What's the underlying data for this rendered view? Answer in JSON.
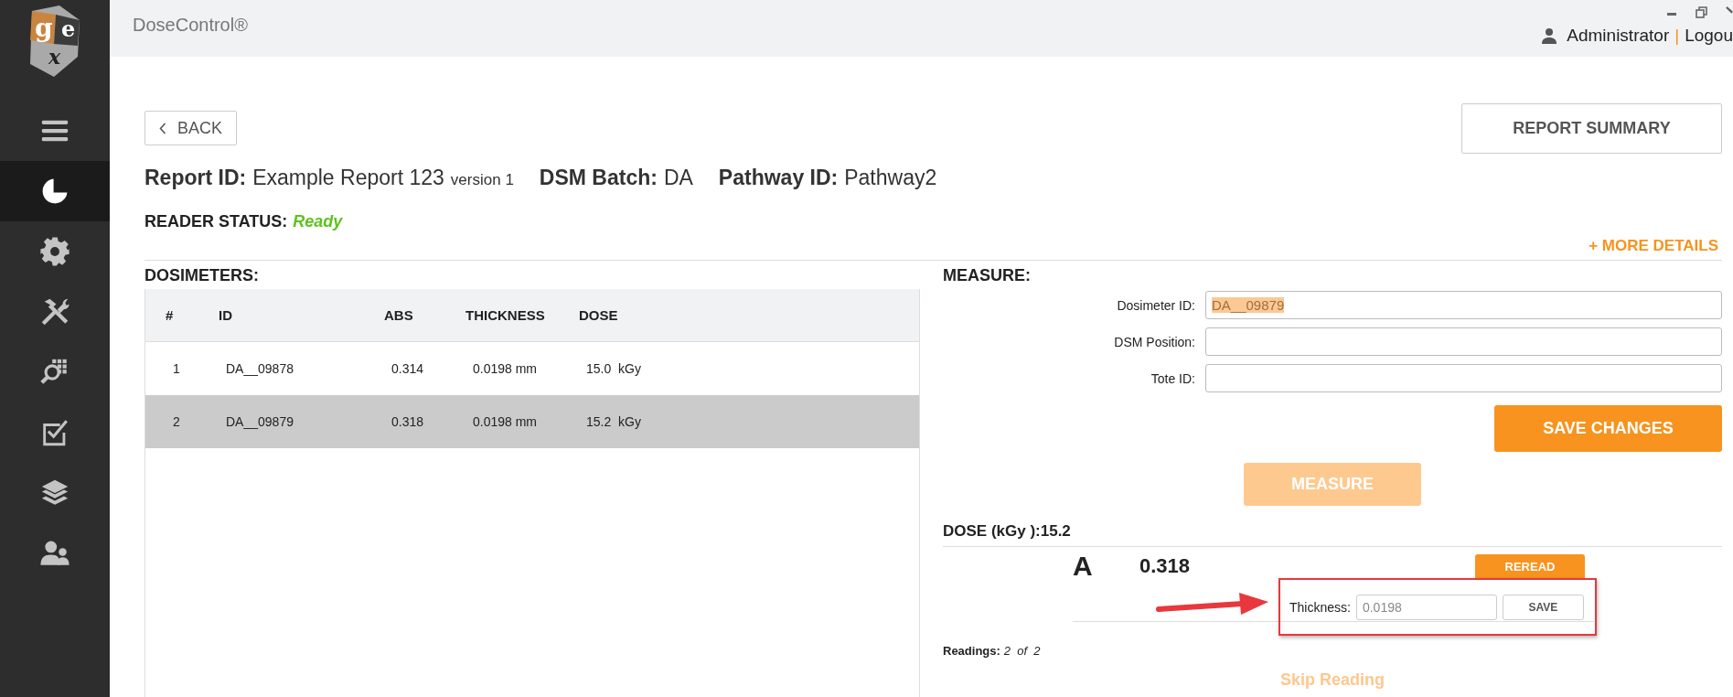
{
  "logo": {
    "letters": [
      "g",
      "e",
      "x"
    ]
  },
  "app": {
    "title": "DoseControl®"
  },
  "user": {
    "name": "Administrator",
    "separator": "|",
    "logout": "Logou"
  },
  "sidebar": {
    "items": [
      {
        "kind": "menu",
        "selected": false
      },
      {
        "kind": "pie",
        "selected": true
      },
      {
        "kind": "gear",
        "selected": false
      },
      {
        "kind": "tools",
        "selected": false
      },
      {
        "kind": "search",
        "selected": false
      },
      {
        "kind": "checklist",
        "selected": false
      },
      {
        "kind": "layers",
        "selected": false
      },
      {
        "kind": "users",
        "selected": false
      }
    ]
  },
  "back_button": "BACK",
  "report_summary_button": "REPORT SUMMARY",
  "report_info": [
    {
      "label": "Report ID:",
      "value": "Example Report 123",
      "suffix": "version 1"
    },
    {
      "label": "DSM Batch:",
      "value": "DA"
    },
    {
      "label": "Pathway ID:",
      "value": "Pathway2"
    }
  ],
  "reader_status": {
    "label": "READER STATUS:",
    "value": "Ready"
  },
  "more_details": "+ MORE DETAILS",
  "dosimeters": {
    "title": "DOSIMETERS:",
    "columns": [
      "#",
      "ID",
      "ABS",
      "THICKNESS",
      "DOSE"
    ],
    "rows": [
      {
        "cells": [
          "1",
          "DA__09878",
          "0.314",
          "0.0198 mm",
          "15.0  kGy"
        ],
        "selected": false
      },
      {
        "cells": [
          "2",
          "DA__09879",
          "0.318",
          "0.0198 mm",
          "15.2  kGy"
        ],
        "selected": true
      }
    ]
  },
  "measure": {
    "title": "MEASURE:",
    "fields": [
      {
        "label": "Dosimeter ID:",
        "value": "DA__09879",
        "text_selected": true
      },
      {
        "label": "DSM Position:"
      },
      {
        "label": "Tote ID:"
      }
    ],
    "save_button": "SAVE CHANGES",
    "measure_button": {
      "label": "MEASURE",
      "disabled": true
    }
  },
  "dose": {
    "title": "DOSE (kGy ):15.2",
    "reading": {
      "letter": "A",
      "value": "0.318"
    },
    "reread_button": "REREAD",
    "thickness": {
      "label": "Thickness:",
      "placeholder": "0.0198"
    },
    "save_button": "SAVE",
    "readings": {
      "label": "Readings:",
      "value": "2  of  2"
    },
    "skip_button": {
      "label": "Skip Reading",
      "disabled": true
    }
  }
}
